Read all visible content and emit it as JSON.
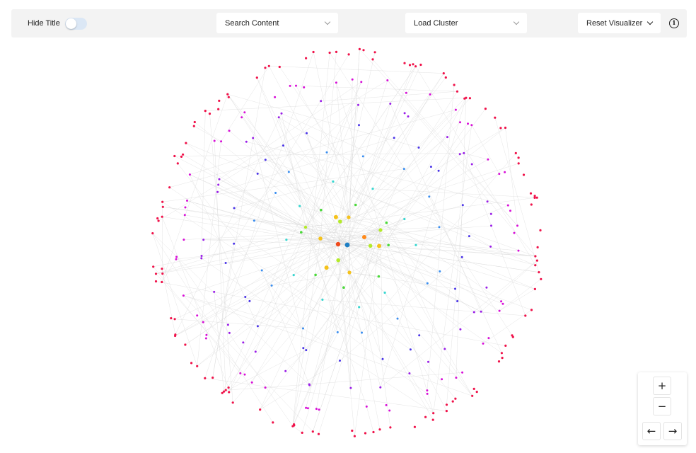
{
  "toolbar": {
    "hide_title_label": "Hide Title",
    "hide_title_on": false,
    "search_label": "Search Content",
    "cluster_label": "Load Cluster",
    "reset_label": "Reset Visualizer",
    "info_glyph": "i"
  },
  "controls": {
    "zoom_in": "+",
    "zoom_out": "−",
    "pan_left": "←",
    "pan_right": "→"
  },
  "colors": {
    "edge": "#d8d8d8",
    "rings": [
      "#f0124a",
      "#d80fd8",
      "#9a1ee8",
      "#4a34e8",
      "#3a8ef0",
      "#38d6d0",
      "#4bd93a",
      "#b4ea2a",
      "#f5c21b",
      "#ff8a1a",
      "#f04a1c",
      "#1e7fc4"
    ]
  },
  "graph": {
    "ring_node_counts": [
      120,
      60,
      40,
      26,
      16,
      10,
      8,
      3,
      3
    ]
  }
}
